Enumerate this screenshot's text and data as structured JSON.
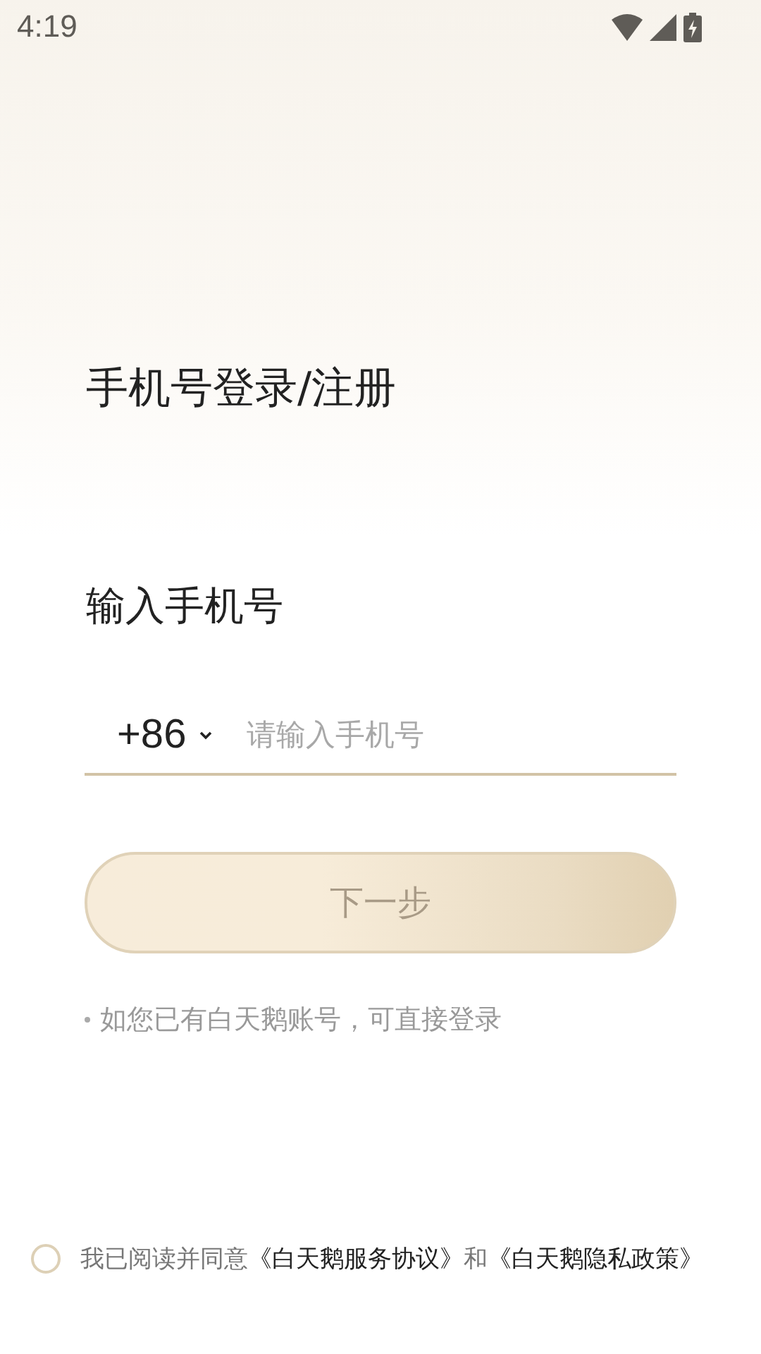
{
  "status_bar": {
    "time": "4:19"
  },
  "title": "手机号登录/注册",
  "phone_label": "输入手机号",
  "phone_field": {
    "country_code": "+86",
    "placeholder": "请输入手机号"
  },
  "next_button": {
    "label": "下一步",
    "disabled": true
  },
  "hint": "如您已有白天鹅账号，可直接登录",
  "agreement": {
    "checked": false,
    "parts": [
      {
        "kind": "text",
        "text": "我已阅读并同意"
      },
      {
        "kind": "link",
        "text": "《白天鹅服务协议》"
      },
      {
        "kind": "text",
        "text": "和"
      },
      {
        "kind": "link",
        "text": "《白天鹅隐私政策》"
      }
    ]
  }
}
